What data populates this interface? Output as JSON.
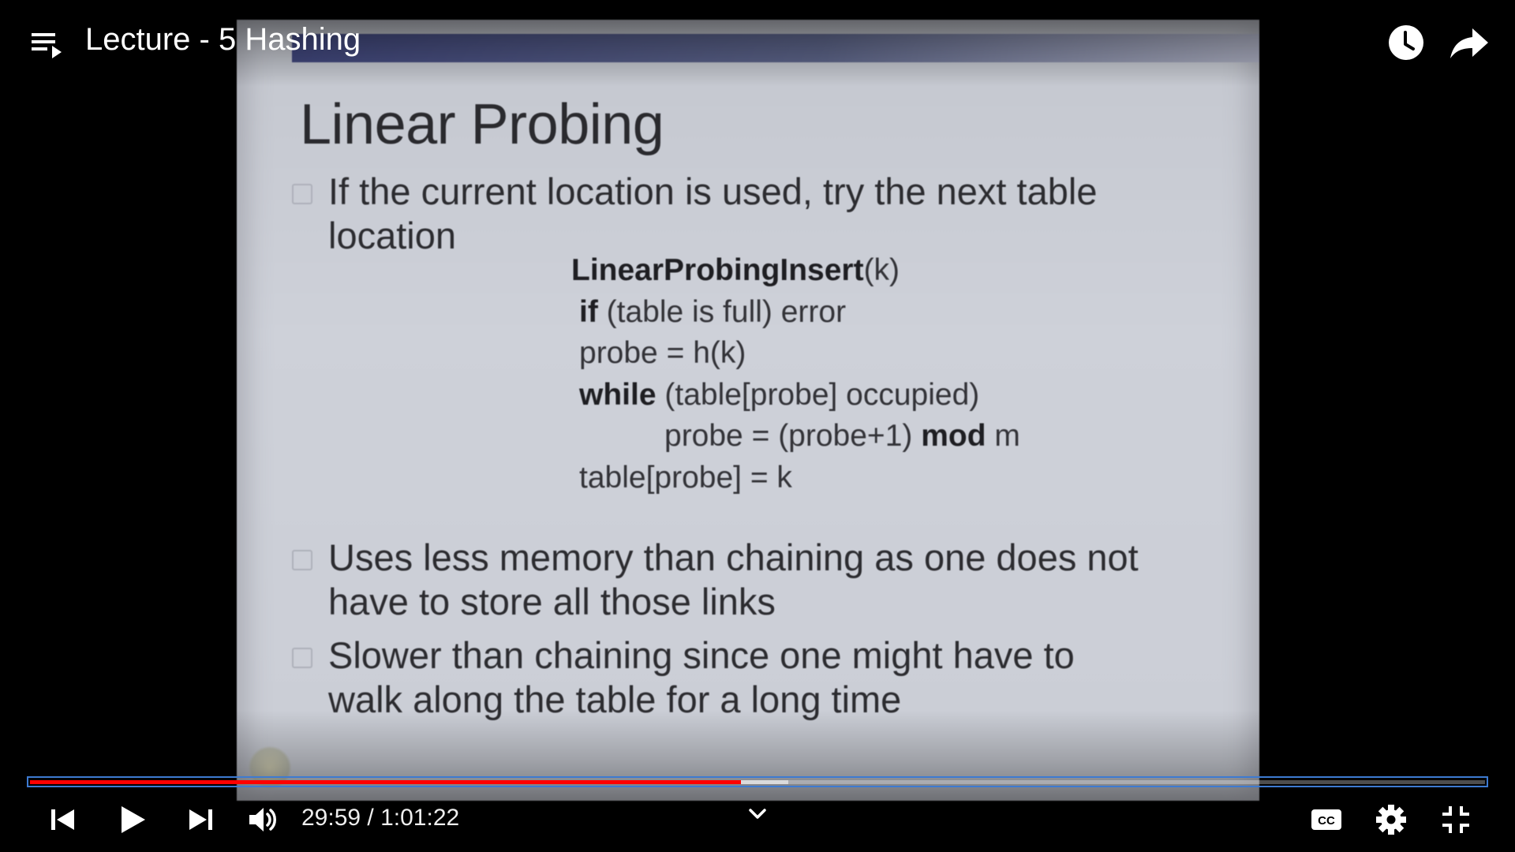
{
  "video": {
    "title": "Lecture - 5 Hashing",
    "current_time": "29:59",
    "duration": "1:01:22",
    "time_separator": " / ",
    "progress_played": 0.4886,
    "progress_buffered": 0.5212
  },
  "slide": {
    "title": "Linear Probing",
    "bullets": [
      {
        "line1": "If the current location is used, try the next table",
        "line2": "location"
      },
      {
        "line1": "Uses less memory than chaining as one does not",
        "line2": "have to store all those links"
      },
      {
        "line1": "Slower than chaining since one might have to",
        "line2": "walk along the table for a long time"
      }
    ],
    "code": {
      "fn_name": "LinearProbingInsert",
      "fn_args": "(k)",
      "kw_if": "if",
      "if_rest": " (table is full) error",
      "probe_init": "probe = h(k)",
      "kw_while": "while",
      "while_rest": " (table[probe] occupied)",
      "probe_step": "probe = (probe+1) ",
      "kw_mod": "mod",
      "mod_rest": " m",
      "assign": "table[probe] = k"
    }
  },
  "icons": {
    "playlist": "playlist-icon",
    "watch_later": "clock-icon",
    "share": "share-arrow-icon",
    "previous": "skip-previous-icon",
    "play": "play-icon",
    "next": "skip-next-icon",
    "volume": "volume-icon",
    "chevron": "chevron-down-icon",
    "captions": "cc-icon",
    "settings": "gear-icon",
    "exit_fullscreen": "exit-fullscreen-icon"
  },
  "colors": {
    "progress_played": "#ff0000",
    "progress_focus_outline": "#3d7ad1"
  }
}
